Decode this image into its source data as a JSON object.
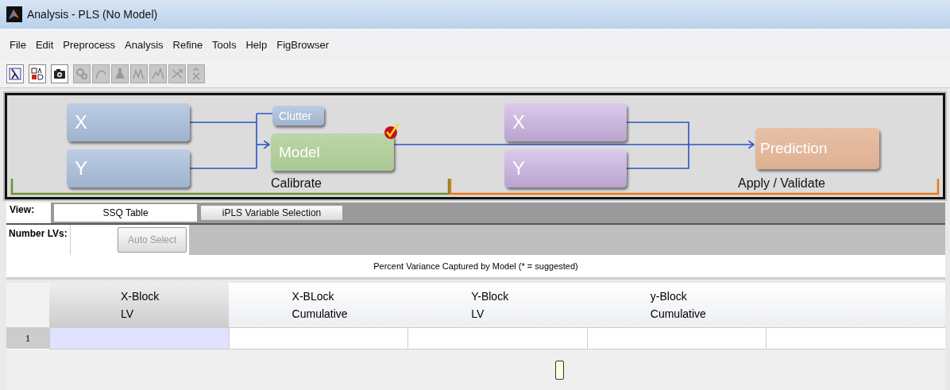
{
  "window": {
    "title": "Analysis - PLS (No Model)"
  },
  "menu": [
    "File",
    "Edit",
    "Preprocess",
    "Analysis",
    "Refine",
    "Tools",
    "Help",
    "FigBrowser"
  ],
  "toolbar": [
    {
      "kind": "lambda",
      "disabled": false
    },
    {
      "kind": "ab",
      "disabled": false
    },
    {
      "kind": "camera",
      "disabled": false
    },
    {
      "kind": "gears",
      "disabled": true
    },
    {
      "kind": "curve",
      "disabled": true
    },
    {
      "kind": "flask",
      "disabled": true
    },
    {
      "kind": "peaks",
      "disabled": true
    },
    {
      "kind": "peaks2",
      "disabled": true
    },
    {
      "kind": "arrows",
      "disabled": true
    },
    {
      "kind": "xhat",
      "disabled": true
    }
  ],
  "diagram": {
    "calibrate": {
      "label": "Calibrate",
      "x_block": "X",
      "y_block": "Y",
      "clutter": "Clutter",
      "model": "Model",
      "model_checked": true
    },
    "apply": {
      "label": "Apply / Validate",
      "x_block": "X",
      "y_block": "Y",
      "prediction": "Prediction"
    }
  },
  "view": {
    "label": "View:",
    "value": "SSQ Table",
    "button": "iPLS Variable Selection"
  },
  "lvs": {
    "label": "Number LVs:",
    "button": "Auto Select",
    "button_disabled": true
  },
  "table": {
    "caption": "Percent Variance Captured by Model (* = suggested)",
    "columns": [
      "X-Block\nLV",
      "X-BLock\nCumulative",
      "Y-Block\nLV",
      "y-Block\nCumulative"
    ],
    "rows": [
      {
        "label": "1",
        "cells": [
          {
            "selected": true
          },
          {
            "selected": false
          },
          {
            "selected": false
          },
          {
            "selected": false
          },
          {
            "selected": false
          }
        ]
      }
    ]
  }
}
